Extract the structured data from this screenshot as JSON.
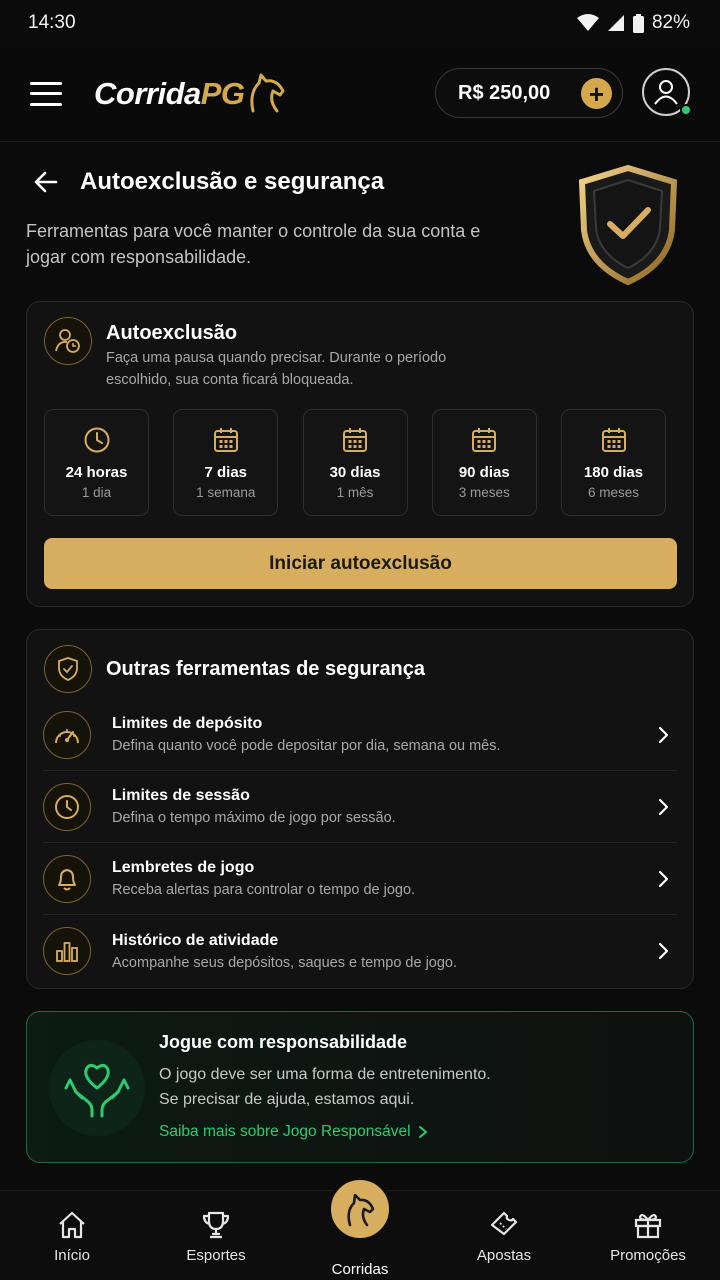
{
  "status": {
    "time": "14:30",
    "battery": "82%"
  },
  "header": {
    "logo_main": "Corrida",
    "logo_accent": "PG",
    "balance": "R$ 250,00"
  },
  "page": {
    "title": "Autoexclusão e segurança",
    "description": "Ferramentas para você manter o controle da sua conta e jogar com responsabilidade."
  },
  "self_exclusion": {
    "title": "Autoexclusão",
    "subtitle": "Faça uma pausa quando precisar. Durante o período escolhido, sua conta ficará bloqueada.",
    "options": [
      {
        "label": "24 horas",
        "sub": "1 dia",
        "icon": "clock-icon"
      },
      {
        "label": "7 dias",
        "sub": "1 semana",
        "icon": "calendar-icon"
      },
      {
        "label": "30 dias",
        "sub": "1 mês",
        "icon": "calendar-icon"
      },
      {
        "label": "90 dias",
        "sub": "3 meses",
        "icon": "calendar-icon"
      },
      {
        "label": "180 dias",
        "sub": "6 meses",
        "icon": "calendar-icon"
      }
    ],
    "button": "Iniciar autoexclusão"
  },
  "tools": {
    "title": "Outras ferramentas de segurança",
    "items": [
      {
        "title": "Limites de depósito",
        "desc": "Defina quanto você pode depositar por dia, semana ou mês.",
        "icon": "gauge-icon"
      },
      {
        "title": "Limites de sessão",
        "desc": "Defina o tempo máximo de jogo por sessão.",
        "icon": "clock-icon"
      },
      {
        "title": "Lembretes de jogo",
        "desc": "Receba alertas para controlar o tempo de jogo.",
        "icon": "bell-icon"
      },
      {
        "title": "Histórico de atividade",
        "desc": "Acompanhe seus depósitos, saques e tempo de jogo.",
        "icon": "bar-chart-icon"
      }
    ]
  },
  "responsible": {
    "title": "Jogue com responsabilidade",
    "text_line1": "O jogo deve ser uma forma de entretenimento.",
    "text_line2": "Se precisar de ajuda, estamos aqui.",
    "link": "Saiba mais sobre Jogo Responsável"
  },
  "nav": {
    "items": [
      {
        "label": "Início",
        "icon": "home-icon"
      },
      {
        "label": "Esportes",
        "icon": "trophy-icon"
      },
      {
        "label": "Corridas",
        "icon": "horse-icon"
      },
      {
        "label": "Apostas",
        "icon": "ticket-icon"
      },
      {
        "label": "Promoções",
        "icon": "gift-icon"
      }
    ]
  },
  "colors": {
    "gold": "#d7ae5f",
    "green": "#2ecc71",
    "background": "#0b0b0b",
    "card": "#121212"
  }
}
